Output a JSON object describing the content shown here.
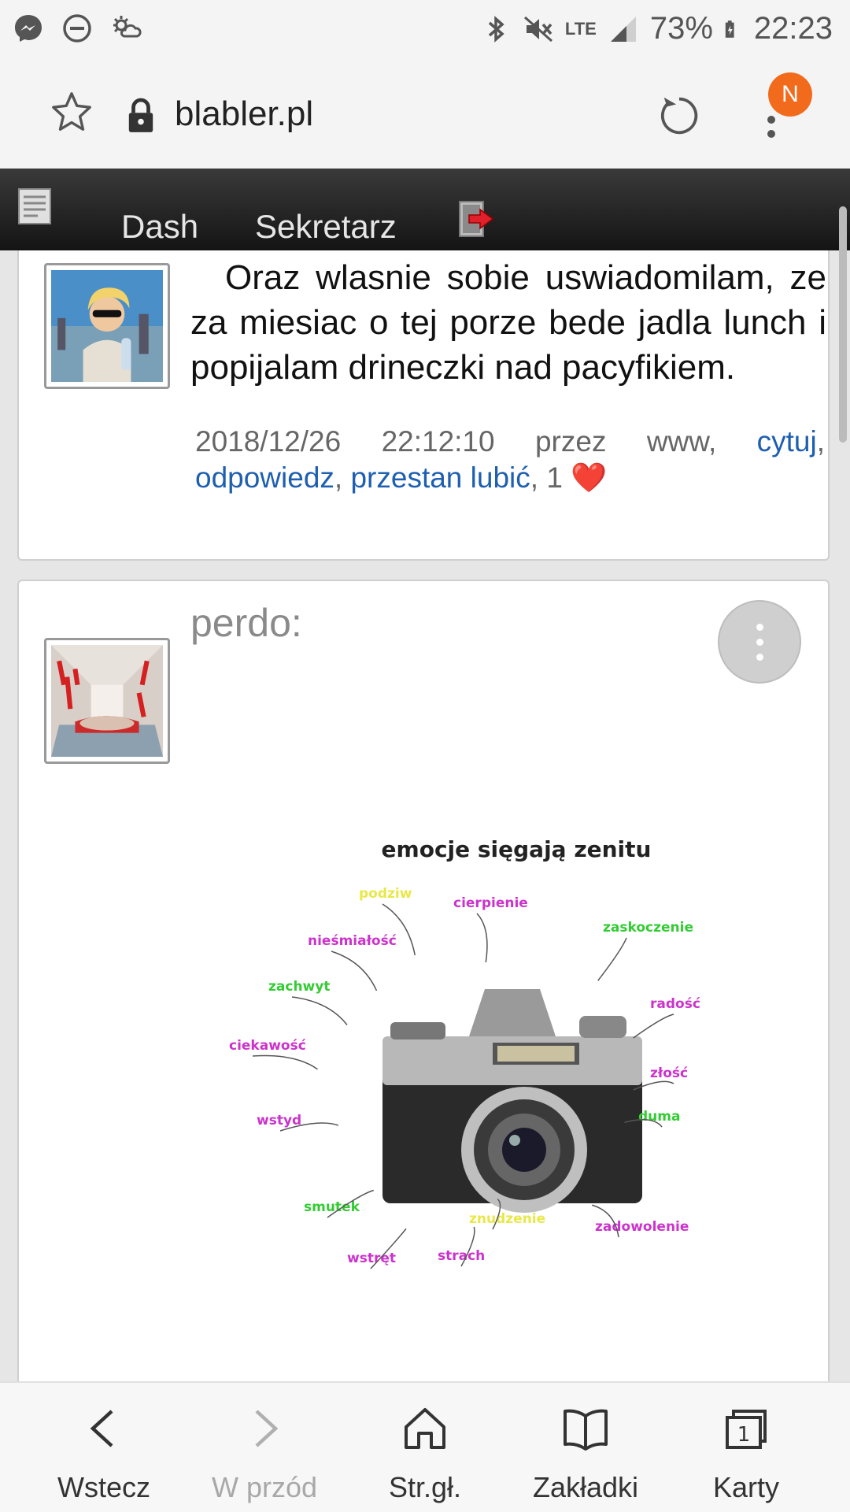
{
  "status_bar": {
    "battery": "73%",
    "time": "22:23",
    "network": "LTE",
    "icons": [
      "messenger-icon",
      "dnd-icon",
      "weather-icon",
      "bluetooth-icon",
      "mute-icon",
      "signal-icon",
      "battery-icon"
    ]
  },
  "browser": {
    "url": "blabler.pl",
    "profile_initial": "N"
  },
  "site_nav": {
    "items": [
      {
        "label": "Dash"
      },
      {
        "label": "Sekretarz"
      }
    ]
  },
  "posts": [
    {
      "text": "Oraz wlasnie sobie uswiadomilam, ze za miesiac o tej porze bede jadla lunch i popijalam drineczki nad pacyfikiem.",
      "meta_date": "2018/12/26 22:12:10",
      "meta_via": "przez www,",
      "links": {
        "quote": "cytuj",
        "reply": "odpowiedz",
        "unlike": "przestan lubić"
      },
      "likes": "1",
      "heart": "❤️"
    },
    {
      "author": "perdo:",
      "image": {
        "title": "emocje sięgają zenitu",
        "labels": [
          {
            "text": "podziw",
            "color": "#e8e84a"
          },
          {
            "text": "cierpienie",
            "color": "#cc33cc"
          },
          {
            "text": "zaskoczenie",
            "color": "#33cc33"
          },
          {
            "text": "nieśmiałość",
            "color": "#cc33cc"
          },
          {
            "text": "radość",
            "color": "#cc33cc"
          },
          {
            "text": "zachwyt",
            "color": "#33cc33"
          },
          {
            "text": "ciekawość",
            "color": "#cc33cc"
          },
          {
            "text": "złość",
            "color": "#cc33cc"
          },
          {
            "text": "duma",
            "color": "#33cc33"
          },
          {
            "text": "wstyd",
            "color": "#cc33cc"
          },
          {
            "text": "smutek",
            "color": "#33cc33"
          },
          {
            "text": "znudzenie",
            "color": "#e8e84a"
          },
          {
            "text": "zadowolenie",
            "color": "#cc33cc"
          },
          {
            "text": "wstręt",
            "color": "#cc33cc"
          },
          {
            "text": "strach",
            "color": "#cc33cc"
          }
        ]
      }
    }
  ],
  "bottom_bar": {
    "items": [
      {
        "label": "Wstecz",
        "icon": "back-icon",
        "enabled": true
      },
      {
        "label": "W przód",
        "icon": "forward-icon",
        "enabled": false
      },
      {
        "label": "Str.gł.",
        "icon": "home-icon",
        "enabled": true
      },
      {
        "label": "Zakładki",
        "icon": "bookmarks-icon",
        "enabled": true
      },
      {
        "label": "Karty",
        "icon": "tabs-icon",
        "enabled": true
      }
    ],
    "tabs_count": "1"
  },
  "colors": {
    "link": "#1e5fb0",
    "profile_badge": "#f26b1d",
    "nav_bg": "#1a1a1a"
  }
}
